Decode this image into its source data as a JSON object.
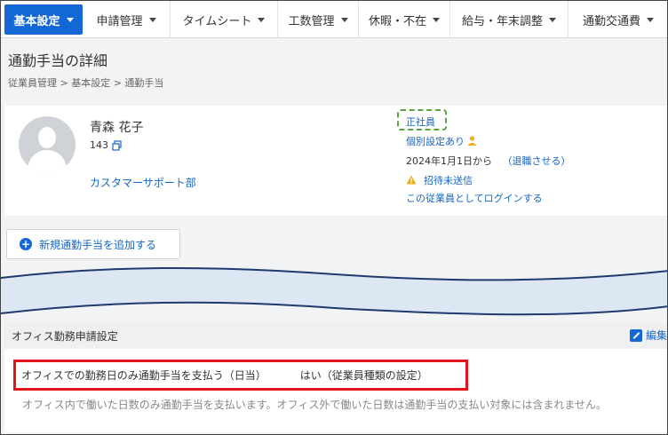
{
  "nav": {
    "items": [
      {
        "label": "基本設定",
        "active": true
      },
      {
        "label": "申請管理",
        "active": false
      },
      {
        "label": "タイムシート",
        "active": false
      },
      {
        "label": "工数管理",
        "active": false
      },
      {
        "label": "休暇・不在",
        "active": false
      },
      {
        "label": "給与・年末調整",
        "active": false
      },
      {
        "label": "通勤交通費",
        "active": false
      }
    ]
  },
  "page": {
    "title": "通勤手当の詳細",
    "breadcrumb": "従業員管理 > 基本設定 > 通勤手当"
  },
  "employee": {
    "name": "青森 花子",
    "id": "143",
    "department": "カスタマーサポート部",
    "employment_type": "正社員",
    "individual_setting": "個別設定あり",
    "start_date": "2024年1月1日から",
    "retire_link": "（退職させる）",
    "invite_status": "招待未送信",
    "login_as": "この従業員としてログインする"
  },
  "actions": {
    "add_allowance": "新規通勤手当を追加する"
  },
  "office_section": {
    "title": "オフィス勤務申請設定",
    "edit_label": "編集",
    "setting_label": "オフィスでの勤務日のみ通勤手当を支払う（日当）",
    "setting_value": "はい（従業員種類の設定）",
    "description": "オフィス内で働いた日数のみ通勤手当を支払います。オフィス外で働いた日数は通勤手当の支払い対象には含まれません。"
  },
  "colors": {
    "primary": "#1468d6",
    "link": "#1666c5",
    "highlight_border": "#e1141b",
    "status_border": "#5aa43c",
    "warning": "#f0ad1a"
  }
}
